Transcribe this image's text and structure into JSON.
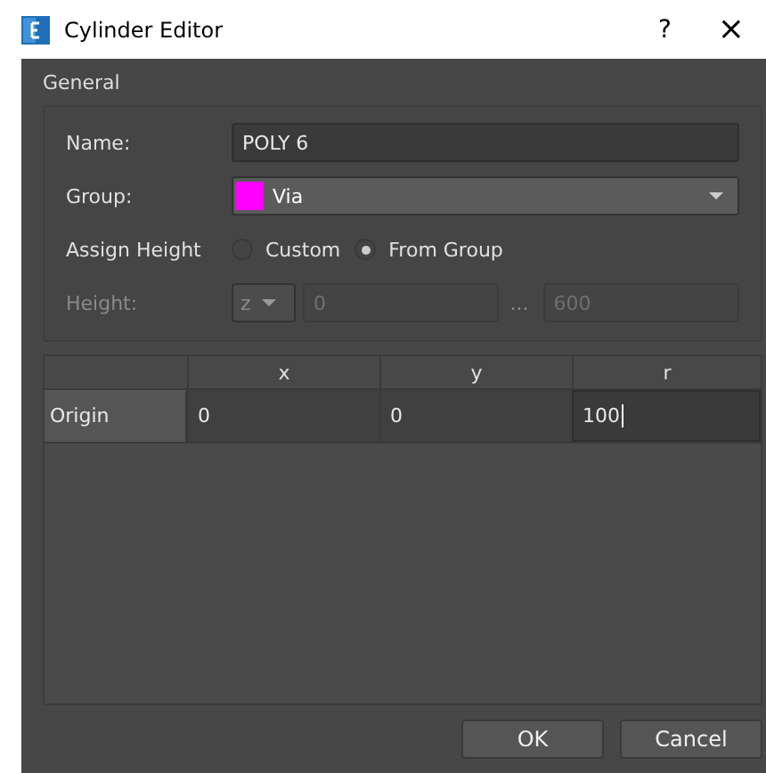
{
  "window": {
    "title": "Cylinder Editor",
    "help": "?",
    "close": "×"
  },
  "general": {
    "title": "General",
    "name_label": "Name:",
    "name_value": "POLY 6",
    "group": {
      "label": "Group:",
      "value": "Via",
      "color": "#ff00ff"
    },
    "assign_label": "Assign Height",
    "radios": [
      {
        "label": "Custom",
        "selected": false
      },
      {
        "label": "From Group",
        "selected": true
      }
    ],
    "height": {
      "label": "Height:",
      "disabled": true,
      "axis": "z",
      "from": "0",
      "separator": "...",
      "to": "600"
    }
  },
  "table": {
    "columns": [
      "x",
      "y",
      "r"
    ],
    "rows": [
      {
        "header": "Origin",
        "cells": [
          "0",
          "0",
          "100"
        ]
      }
    ]
  },
  "buttons": [
    "OK",
    "Cancel"
  ]
}
